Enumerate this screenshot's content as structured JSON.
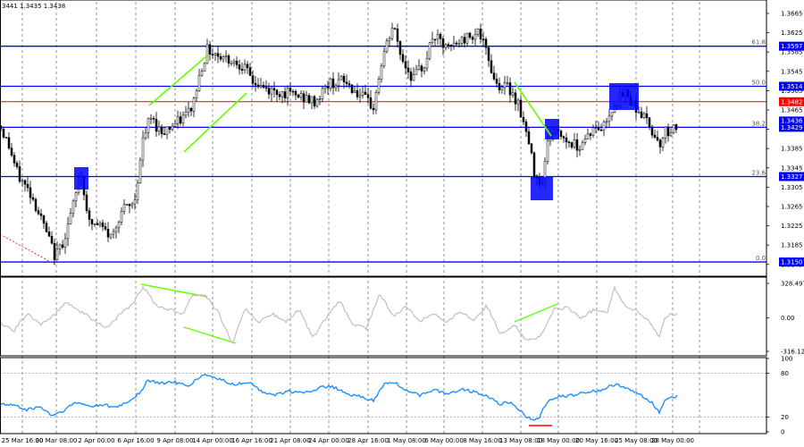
{
  "header": {
    "quote": "3441 1.3435 1.3438"
  },
  "colors": {
    "candle": "#000000",
    "fib_line": "#0000ff",
    "fib_box": "#0000ff",
    "fib_box_text": "#ffffff",
    "red_line": "#ff0000",
    "green_line": "#66ff00",
    "cci_line": "#c0c0c0",
    "rsi_line": "#1e90ff",
    "grid": "#000000"
  },
  "chart_data": [
    {
      "type": "candlestick",
      "panel": "price",
      "ylim": [
        1.3139,
        1.3689
      ],
      "price_ticks": [
        1.3665,
        1.3625,
        1.3585,
        1.3545,
        1.3505,
        1.3465,
        1.3425,
        1.3385,
        1.3345,
        1.3305,
        1.3265,
        1.3225,
        1.3185,
        1.3145
      ],
      "fib_levels": [
        {
          "label": "61.8",
          "price": 1.3597,
          "tag": "1.3597"
        },
        {
          "label": "50.0",
          "price": 1.3514,
          "tag": "1.3514"
        },
        {
          "label": "38.2",
          "price": 1.3429,
          "tag": "1.3429"
        },
        {
          "label": "23.6",
          "price": 1.3327,
          "tag": "1.3327"
        },
        {
          "label": "0.0",
          "price": 1.315,
          "tag": "1.3150"
        }
      ],
      "extra_tags": [
        "1.3436"
      ],
      "red_line": {
        "price": 1.3482,
        "tag": "1.3482"
      },
      "x_ticks": [
        "25 Mar 16:00",
        "30 Mar 08:00",
        "2 Apr 00:00",
        "6 Apr 16:00",
        "9 Apr 08:00",
        "14 Apr 00:00",
        "16 Apr 16:00",
        "21 Apr 08:00",
        "24 Apr 00:00",
        "28 Apr 16:00",
        "1 May 08:00",
        "6 May 00:00",
        "8 May 16:00",
        "13 May 08:00",
        "18 May 00:00",
        "20 May 16:00",
        "25 May 08:00",
        "28 May 00:00"
      ],
      "waypoints": [
        [
          0,
          1.3432
        ],
        [
          10,
          1.339
        ],
        [
          20,
          1.333
        ],
        [
          35,
          1.329
        ],
        [
          48,
          1.323
        ],
        [
          62,
          1.316
        ],
        [
          72,
          1.32
        ],
        [
          84,
          1.328
        ],
        [
          90,
          1.334
        ],
        [
          100,
          1.323
        ],
        [
          112,
          1.3225
        ],
        [
          125,
          1.32
        ],
        [
          135,
          1.3255
        ],
        [
          150,
          1.327
        ],
        [
          160,
          1.34
        ],
        [
          168,
          1.345
        ],
        [
          180,
          1.342
        ],
        [
          200,
          1.344
        ],
        [
          215,
          1.347
        ],
        [
          225,
          1.355
        ],
        [
          232,
          1.359
        ],
        [
          250,
          1.3575
        ],
        [
          270,
          1.356
        ],
        [
          285,
          1.352
        ],
        [
          300,
          1.3505
        ],
        [
          320,
          1.35
        ],
        [
          340,
          1.349
        ],
        [
          352,
          1.348
        ],
        [
          368,
          1.352
        ],
        [
          385,
          1.3525
        ],
        [
          400,
          1.35
        ],
        [
          418,
          1.347
        ],
        [
          428,
          1.357
        ],
        [
          440,
          1.364
        ],
        [
          450,
          1.357
        ],
        [
          462,
          1.353
        ],
        [
          475,
          1.356
        ],
        [
          485,
          1.362
        ],
        [
          500,
          1.359
        ],
        [
          518,
          1.361
        ],
        [
          535,
          1.363
        ],
        [
          545,
          1.358
        ],
        [
          555,
          1.352
        ],
        [
          570,
          1.351
        ],
        [
          580,
          1.348
        ],
        [
          590,
          1.341
        ],
        [
          598,
          1.334
        ],
        [
          606,
          1.331
        ],
        [
          615,
          1.342
        ],
        [
          625,
          1.342
        ],
        [
          635,
          1.34
        ],
        [
          648,
          1.339
        ],
        [
          660,
          1.342
        ],
        [
          675,
          1.343
        ],
        [
          688,
          1.348
        ],
        [
          700,
          1.35
        ],
        [
          712,
          1.347
        ],
        [
          725,
          1.344
        ],
        [
          738,
          1.3395
        ],
        [
          745,
          1.342
        ],
        [
          758,
          1.3432
        ]
      ]
    },
    {
      "type": "line",
      "panel": "cci",
      "ylim": [
        -316.127,
        328.4976
      ],
      "ticks": [
        "328.4976",
        "0.00",
        "-316.127"
      ],
      "tick_values": [
        328.4976,
        0,
        -316.127
      ],
      "waypoints": [
        [
          0,
          -40
        ],
        [
          15,
          -130
        ],
        [
          30,
          40
        ],
        [
          45,
          -60
        ],
        [
          60,
          20
        ],
        [
          75,
          160
        ],
        [
          90,
          60
        ],
        [
          105,
          -20
        ],
        [
          120,
          -90
        ],
        [
          135,
          40
        ],
        [
          148,
          120
        ],
        [
          160,
          300
        ],
        [
          175,
          120
        ],
        [
          190,
          80
        ],
        [
          205,
          40
        ],
        [
          215,
          220
        ],
        [
          230,
          220
        ],
        [
          245,
          40
        ],
        [
          260,
          -240
        ],
        [
          275,
          90
        ],
        [
          290,
          -40
        ],
        [
          305,
          40
        ],
        [
          320,
          -40
        ],
        [
          335,
          80
        ],
        [
          350,
          -190
        ],
        [
          365,
          0
        ],
        [
          380,
          160
        ],
        [
          395,
          -60
        ],
        [
          410,
          -100
        ],
        [
          425,
          230
        ],
        [
          440,
          20
        ],
        [
          455,
          110
        ],
        [
          470,
          -30
        ],
        [
          485,
          50
        ],
        [
          500,
          -50
        ],
        [
          515,
          70
        ],
        [
          530,
          -20
        ],
        [
          545,
          120
        ],
        [
          560,
          -160
        ],
        [
          575,
          -60
        ],
        [
          590,
          -210
        ],
        [
          605,
          -180
        ],
        [
          620,
          80
        ],
        [
          635,
          100
        ],
        [
          650,
          0
        ],
        [
          665,
          80
        ],
        [
          680,
          60
        ],
        [
          688,
          290
        ],
        [
          700,
          110
        ],
        [
          712,
          70
        ],
        [
          725,
          -20
        ],
        [
          738,
          -180
        ],
        [
          745,
          20
        ],
        [
          758,
          40
        ]
      ]
    },
    {
      "type": "line",
      "panel": "rsi",
      "ylim": [
        0,
        100
      ],
      "ticks": [
        "100",
        "80",
        "20",
        "0"
      ],
      "tick_values": [
        100,
        80,
        20,
        0
      ],
      "waypoints": [
        [
          0,
          38
        ],
        [
          15,
          36
        ],
        [
          30,
          30
        ],
        [
          45,
          34
        ],
        [
          58,
          22
        ],
        [
          70,
          28
        ],
        [
          85,
          40
        ],
        [
          100,
          35
        ],
        [
          115,
          37
        ],
        [
          130,
          33
        ],
        [
          145,
          42
        ],
        [
          158,
          55
        ],
        [
          165,
          70
        ],
        [
          178,
          66
        ],
        [
          195,
          68
        ],
        [
          210,
          62
        ],
        [
          228,
          78
        ],
        [
          245,
          72
        ],
        [
          262,
          64
        ],
        [
          278,
          68
        ],
        [
          292,
          56
        ],
        [
          308,
          50
        ],
        [
          322,
          56
        ],
        [
          340,
          52
        ],
        [
          358,
          60
        ],
        [
          372,
          62
        ],
        [
          390,
          50
        ],
        [
          405,
          48
        ],
        [
          418,
          42
        ],
        [
          430,
          65
        ],
        [
          442,
          68
        ],
        [
          455,
          55
        ],
        [
          470,
          50
        ],
        [
          485,
          58
        ],
        [
          500,
          52
        ],
        [
          518,
          58
        ],
        [
          532,
          54
        ],
        [
          545,
          50
        ],
        [
          558,
          38
        ],
        [
          572,
          40
        ],
        [
          590,
          20
        ],
        [
          602,
          16
        ],
        [
          612,
          40
        ],
        [
          625,
          48
        ],
        [
          640,
          50
        ],
        [
          655,
          54
        ],
        [
          672,
          56
        ],
        [
          690,
          66
        ],
        [
          702,
          58
        ],
        [
          718,
          50
        ],
        [
          730,
          40
        ],
        [
          738,
          26
        ],
        [
          745,
          46
        ],
        [
          758,
          48
        ]
      ]
    }
  ]
}
